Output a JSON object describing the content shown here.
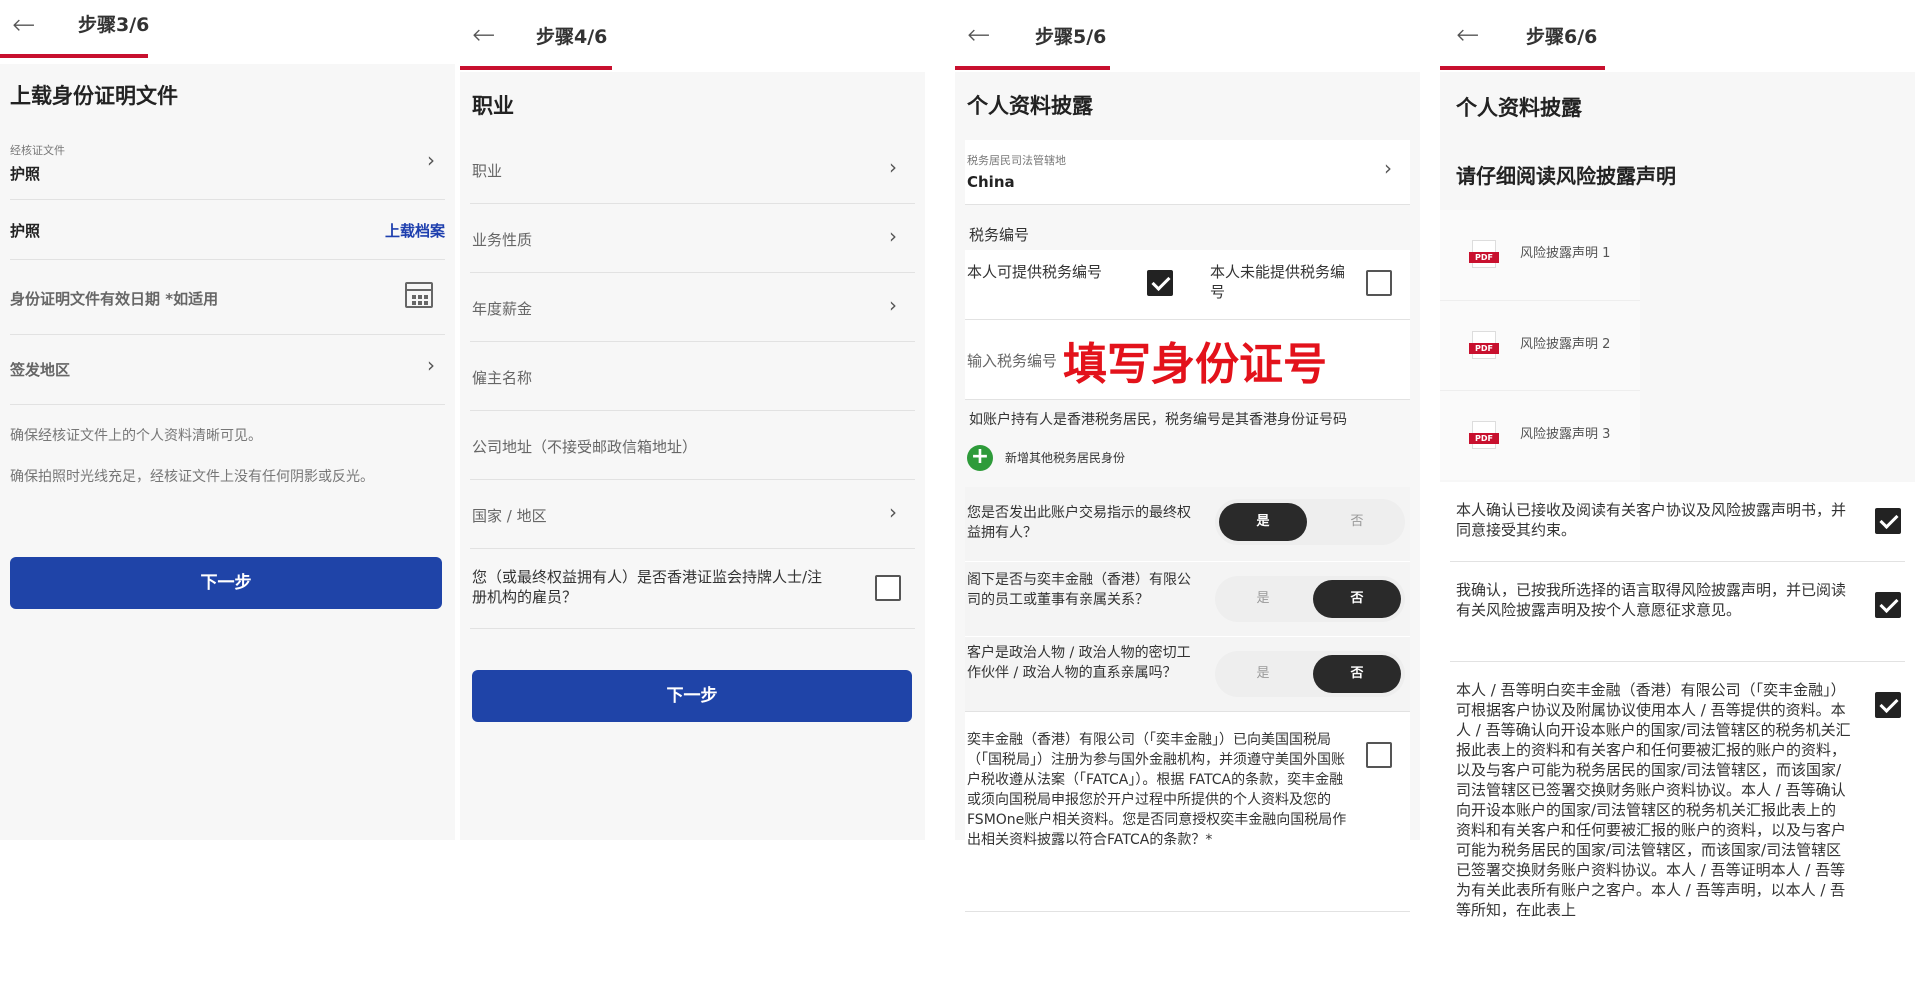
{
  "back_icon": "←",
  "chevron": "›",
  "panel1": {
    "step": "步骤3/6",
    "title": "上载身份证明文件",
    "doc_small_label": "经核证文件",
    "doc_value": "护照",
    "passport_label": "护照",
    "upload_link": "上载档案",
    "expiry_label": "身份证明文件有效日期 *如适用",
    "issuing_region_label": "签发地区",
    "note1": "确保经核证文件上的个人资料清晰可见。",
    "note2": "确保拍照时光线充足，经核证文件上没有任何阴影或反光。",
    "next_button": "下一步"
  },
  "panel2": {
    "step": "步骤4/6",
    "title": "职业",
    "fields": [
      "职业",
      "业务性质",
      "年度薪金",
      "僱主名称",
      "公司地址（不接受邮政信箱地址）",
      "国家 / 地区"
    ],
    "sfc_question": "您（或最终权益拥有人）是否香港证监会持牌人士/注册机构的雇员？",
    "next_button": "下一步"
  },
  "panel3": {
    "step": "步骤5/6",
    "title": "个人资料披露",
    "tax_jurisdiction_label": "税务居民司法管辖地",
    "tax_jurisdiction_value": "China",
    "tax_number_section": "税务编号",
    "can_provide_tin": "本人可提供税务编号",
    "cannot_provide_tin": "本人未能提供税务编号",
    "tin_input_label": "输入税务编号",
    "overlay_annotation": "填写身份证号",
    "hk_note": "如账户持有人是香港税务居民，税务编号是其香港身份证号码",
    "add_tax_residency": "新增其他税务居民身份",
    "q_beneficial_owner": "您是否发出此账户交易指示的最终权益拥有人？",
    "q_employee_relative": "阁下是否与奕丰金融（香港）有限公司的员工或董事有亲属关系？",
    "q_pep": "客户是政治人物 / 政治人物的密切工作伙伴 / 政治人物的直系亲属吗？",
    "yes": "是",
    "no": "否",
    "fatca_text": "奕丰金融（香港）有限公司（「奕丰金融」）已向美国国税局（「国税局」）注册为参与国外金融机构，并须遵守美国外国账户税收遵从法案（「FATCA」）。根据 FATCA的条款，奕丰金融或须向国税局申报您於开户过程中所提供的个人资料及您的FSMOne账户相关资料。您是否同意授权奕丰金融向国税局作出相关资料披露以符合FATCA的条款？*"
  },
  "panel4": {
    "step": "步骤6/6",
    "title": "个人资料披露",
    "subtitle": "请仔细阅读风险披露声明",
    "docs": [
      "风险披露声明 1",
      "风险披露声明 2",
      "风险披露声明 3"
    ],
    "confirm1": "本人确认已接收及阅读有关客户协议及风险披露声明书，并同意接受其约束。",
    "confirm2": "我确认，已按我所选择的语言取得风险披露声明，并已阅读有关风险披露声明及按个人意愿征求意见。",
    "confirm3": "本人 / 吾等明白奕丰金融（香港）有限公司（「奕丰金融」）可根据客户协议及附属协议使用本人 / 吾等提供的资料。本人 / 吾等确认向开设本账户的国家/司法管辖区的税务机关汇报此表上的资料和有关客户和任何要被汇报的账户的资料，以及与客户可能为税务居民的国家/司法管辖区，而该国家/司法管辖区已签署交换财务账户资料协议。本人 / 吾等确认向开设本账户的国家/司法管辖区的税务机关汇报此表上的资料和有关客户和任何要被汇报的账户的资料，以及与客户可能为税务居民的国家/司法管辖区，而该国家/司法管辖区已签署交换财务账户资料协议。本人 / 吾等证明本人 / 吾等为有关此表所有账户之客户。本人 / 吾等声明，以本人 / 吾等所知，在此表上"
  },
  "colors": {
    "accent_red": "#c8102e",
    "button_blue": "#1f44a8",
    "link_blue": "#1e3fae",
    "toggle_dark": "#2a2a2a",
    "plus_green": "#2e9b3a",
    "annotation_red": "#e3121b"
  }
}
